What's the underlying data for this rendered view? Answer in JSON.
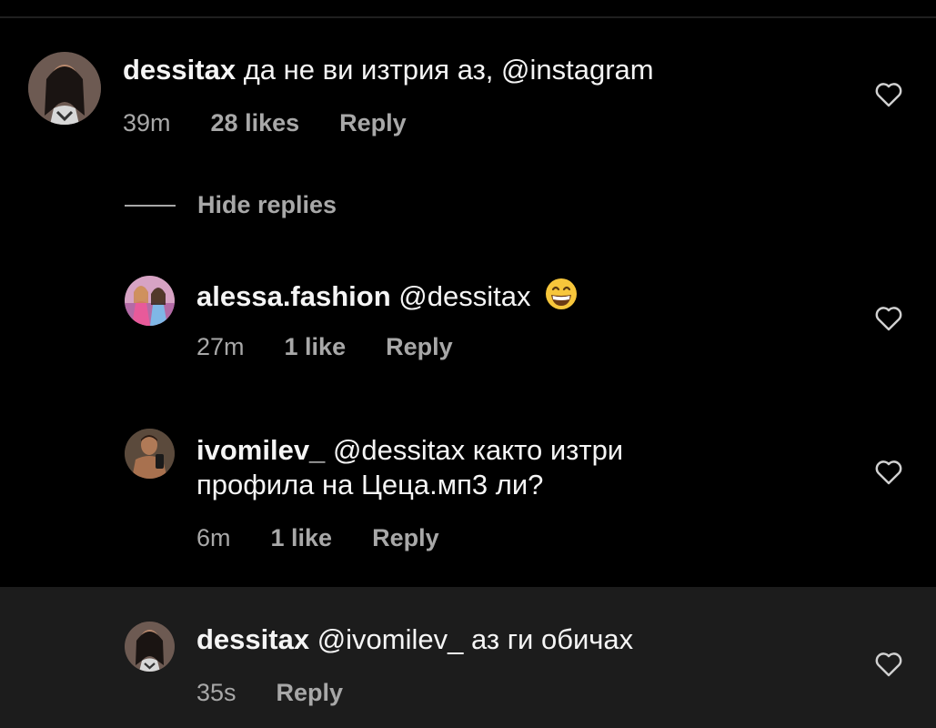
{
  "comments": [
    {
      "username": "dessitax",
      "text": "да не ви изтрия аз, @instagram",
      "time": "39m",
      "likes": "28 likes",
      "reply": "Reply"
    },
    {
      "username": "alessa.fashion",
      "text": "@dessitax",
      "emoji": "grinning-face-emoji",
      "time": "27m",
      "likes": "1 like",
      "reply": "Reply"
    },
    {
      "username": "ivomilev_",
      "text_line1": "@dessitax както изтри",
      "text_line2": "профила на Цеца.мп3 ли?",
      "time": "6m",
      "likes": "1 like",
      "reply": "Reply"
    },
    {
      "username": "dessitax",
      "text": "@ivomilev_ аз ги обичах",
      "time": "35s",
      "reply": "Reply"
    }
  ],
  "hide_replies": "Hide replies",
  "colors": {
    "background": "#000000",
    "highlight_row": "#1c1c1c",
    "primary_text": "#f5f5f5",
    "secondary_text": "#a8a8a8"
  },
  "icons": {
    "like": "heart-outline-icon"
  }
}
